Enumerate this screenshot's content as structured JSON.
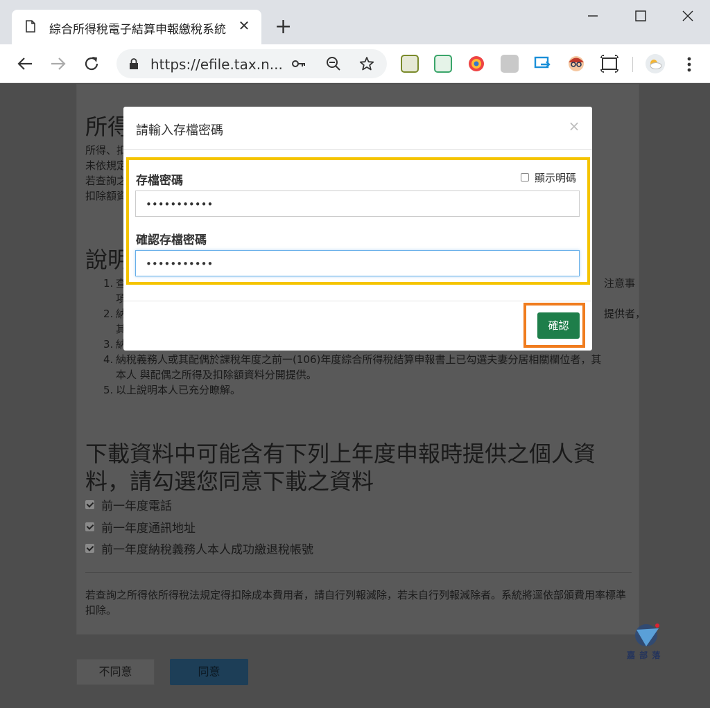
{
  "browser": {
    "tab_title": "綜合所得稅電子結算申報繳稅系統",
    "tab_close": "✕",
    "new_tab": "+",
    "url": "https://efile.tax.n..."
  },
  "page": {
    "heading1": "所得",
    "intro_lines": [
      "所得、扣",
      "未依規定",
      "若查詢之",
      "扣除額資"
    ],
    "heading2": "說明",
    "list_items": [
      {
        "num": "1.",
        "text": "查",
        "tail": "注意事",
        "line2": "項"
      },
      {
        "num": "2.",
        "text": "納",
        "tail": "提供者，",
        "line2": "其"
      },
      {
        "num": "3.",
        "text": "納"
      },
      {
        "num": "4.",
        "text": "納稅義務人或其配偶於課稅年度之前一(106)年度綜合所得稅結算申報書上已勾選夫妻分居相關欄位者，其",
        "line2": "本人 與配偶之所得及扣除額資料分開提供。"
      },
      {
        "num": "5.",
        "text": "以上說明本人已充分瞭解。"
      }
    ],
    "heading3_line1": "下載資料中可能含有下列上年度申報時提供之個人資",
    "heading3_line2": "料，請勾選您同意下載之資料",
    "checkboxes": [
      "前一年度電話",
      "前一年度通訊地址",
      "前一年度納稅義務人本人成功繳退稅帳號"
    ],
    "footer_note": "若查詢之所得依所得稅法規定得扣除成本費用者，請自行列報減除，若未自行列報減除者。系統將逕依部頒費用率標準扣除。",
    "disagree_button": "不同意",
    "agree_button": "同意",
    "watermark_text": "嘉 部 落"
  },
  "modal": {
    "title": "請輸入存檔密碼",
    "close": "×",
    "password_label": "存檔密碼",
    "show_password_label": "顯示明碼",
    "password_value": "•••••••••••",
    "confirm_label": "確認存檔密碼",
    "confirm_value": "•••••••••••",
    "confirm_button": "確認"
  },
  "colors": {
    "highlight_yellow": "#f5c400",
    "highlight_orange": "#f07c1e",
    "confirm_green": "#1e7e4a"
  }
}
